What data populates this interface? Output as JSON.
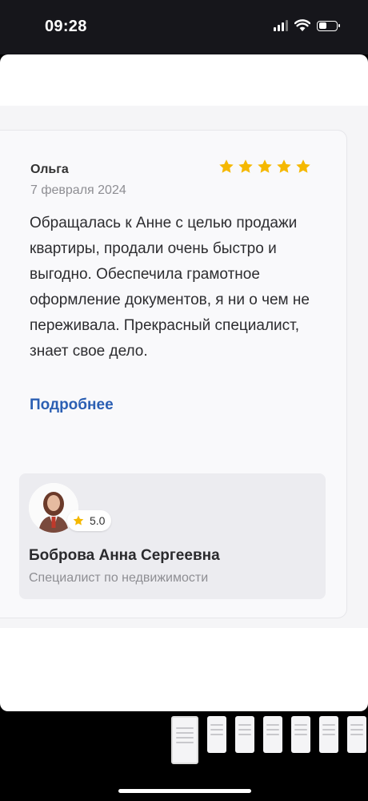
{
  "status_bar": {
    "time": "09:28"
  },
  "review": {
    "author": "Ольга",
    "date": "7 февраля 2024",
    "rating_stars": 5,
    "star_color": "#f5b800",
    "text": "Обращалась к Анне с целью продажи квартиры, продали очень быстро и выгодно. Обеспечила грамотное оформление документов, я ни о чем не переживала. Прекрасный специалист, знает свое дело.",
    "more_label": "Подробнее"
  },
  "agent": {
    "rating": "5.0",
    "name": "Боброва Анна Сергеевна",
    "role": "Специалист по недвижимости"
  },
  "icons": [
    "signal-icon",
    "wifi-icon",
    "battery-icon",
    "star-icon",
    "avatar"
  ]
}
